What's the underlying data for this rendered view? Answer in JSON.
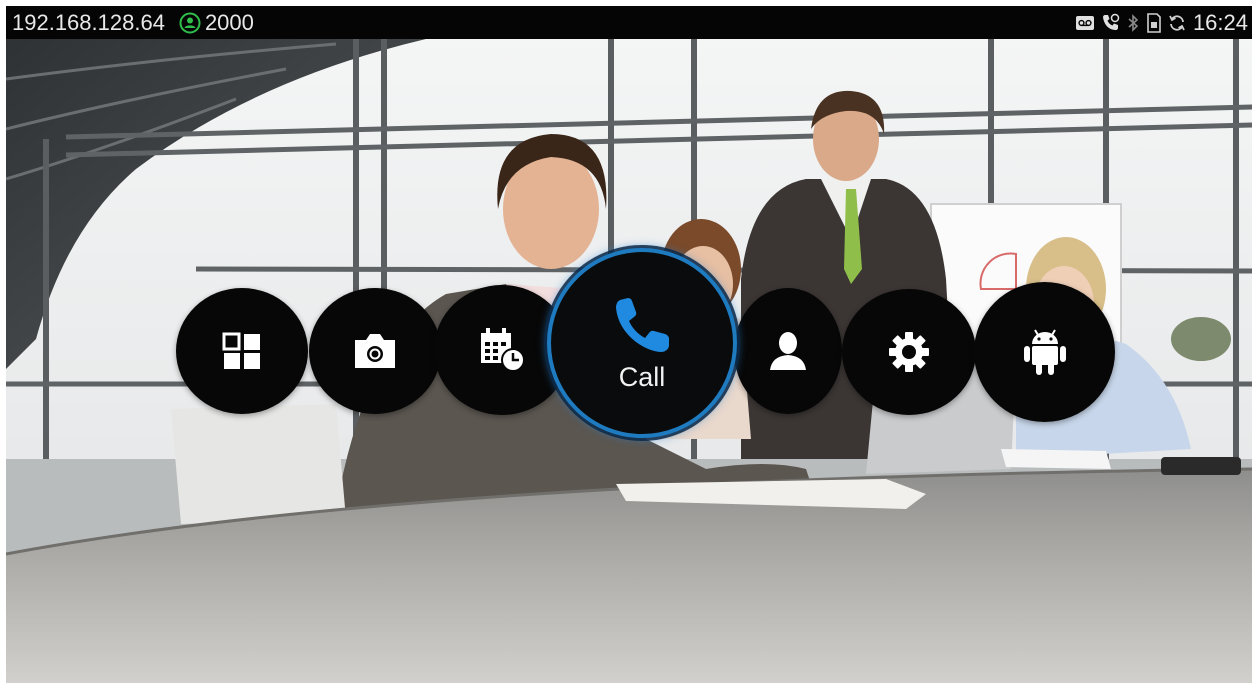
{
  "statusbar": {
    "ip_address": "192.168.128.64",
    "account_number": "2000",
    "time": "16:24",
    "icons": [
      "voicemail-icon",
      "call-forward-icon",
      "bluetooth-icon",
      "sd-card-icon",
      "sync-icon"
    ],
    "account_icon_color": "#2fbf4a"
  },
  "menu": {
    "items": [
      {
        "name": "apps-icon"
      },
      {
        "name": "camera-icon"
      },
      {
        "name": "calendar-icon"
      },
      {
        "name": "call",
        "label": "Call",
        "icon": "phone-icon",
        "selected": true,
        "accent": "#1f8ae0"
      },
      {
        "name": "contacts-icon"
      },
      {
        "name": "settings-icon"
      },
      {
        "name": "android-icon"
      }
    ]
  }
}
